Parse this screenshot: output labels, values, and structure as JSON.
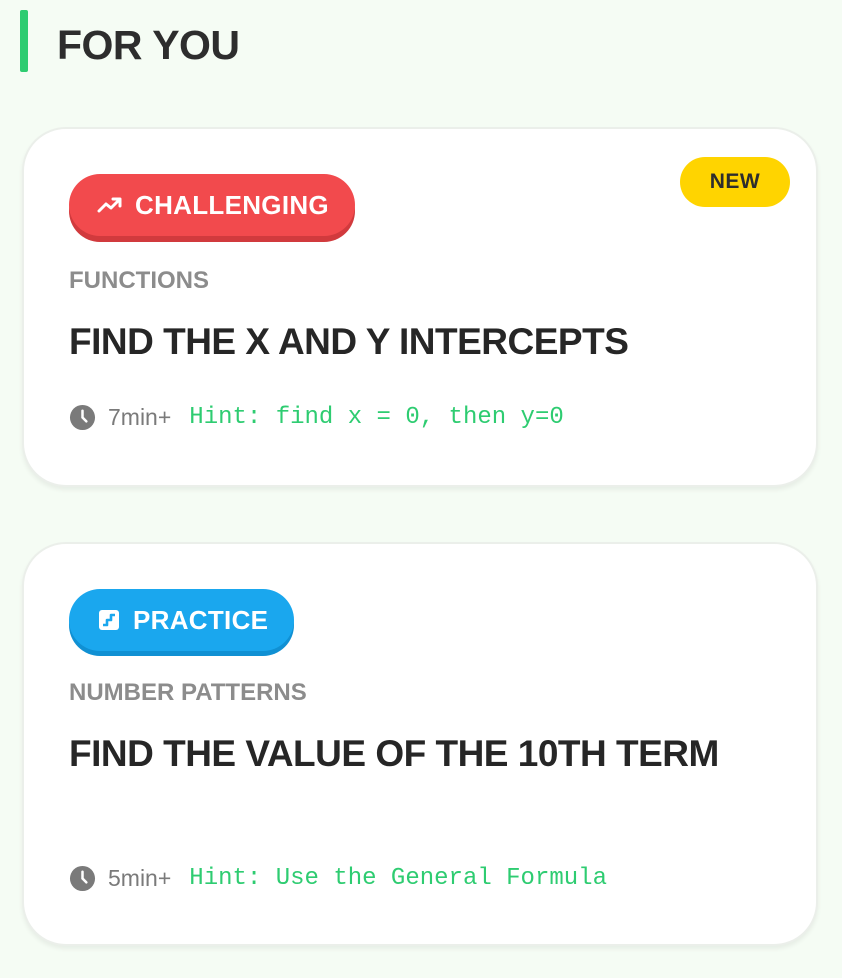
{
  "section": {
    "title": "FOR YOU"
  },
  "cards": [
    {
      "badge": "CHALLENGING",
      "badge_icon": "trending-up-icon",
      "badge_color": "#f24a4d",
      "new_label": "NEW",
      "category": "FUNCTIONS",
      "title": "FIND THE X AND Y INTERCEPTS",
      "duration": "7min+",
      "hint": "Hint: find x = 0, then y=0"
    },
    {
      "badge": "PRACTICE",
      "badge_icon": "practice-icon",
      "badge_color": "#1aa7ee",
      "category": "NUMBER PATTERNS",
      "title": "FIND THE VALUE OF THE 10TH TERM",
      "duration": "5min+",
      "hint": "Hint: Use the General Formula"
    }
  ],
  "colors": {
    "accent": "#2ecc71",
    "new_badge": "#ffd400",
    "background": "#f5fcf4"
  }
}
